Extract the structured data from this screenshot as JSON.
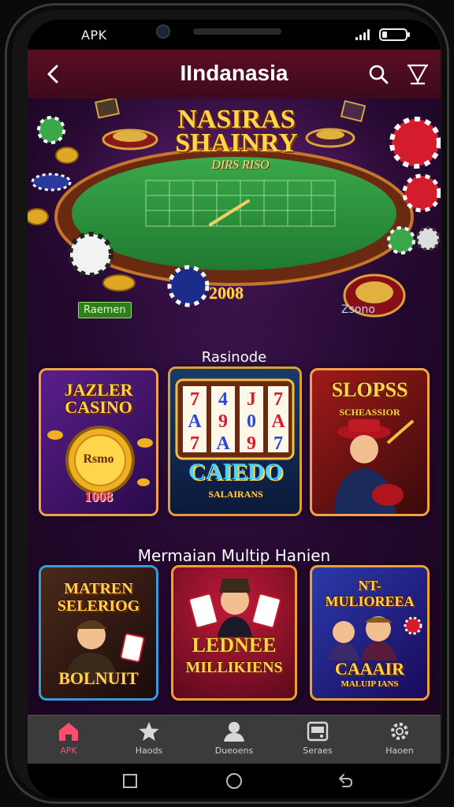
{
  "status_bar": {
    "carrier": "APK"
  },
  "header": {
    "title": "IIndanasia",
    "back_icon": "back-chevron-icon",
    "search_icon": "search-icon",
    "filter_icon": "filter-icon"
  },
  "hero": {
    "title_line1": "NASIRAS",
    "title_line2": "SHAINRY",
    "subtitle": "DIRS RISO",
    "badge_left": "Raemen",
    "number": "2008",
    "badge_right": "Zsono"
  },
  "sections": {
    "section1_title": "Rasinode",
    "section2_title": "Mermaian Multip Hanien"
  },
  "cards_row1": [
    {
      "title_line1": "JAZLER",
      "title_line2": "CASINO",
      "coin_text": "Rsmo",
      "footer": "1008"
    },
    {
      "reel_symbols": "7 4 J 7 | A 9 0 A | 7 A 9 7",
      "title": "CAIEDO",
      "sub": "SALAIRANS"
    },
    {
      "title": "SLOPSS",
      "sub": "SCHEASSIOR"
    }
  ],
  "cards_row2": [
    {
      "title_line1": "MATREN",
      "title_line2": "SELERIOG",
      "footer": "BOLNUIT"
    },
    {
      "title_line1": "LEDNEE",
      "title_line2": "MILLIKIENS"
    },
    {
      "title_line1": "NT-",
      "title_line2": "MULIOREEA",
      "footer": "CAAAIR",
      "footer2": "MALUIP IANS"
    }
  ],
  "bottom_nav": [
    {
      "label": "APK",
      "icon": "home-icon",
      "active": true
    },
    {
      "label": "Haods",
      "icon": "star-icon",
      "active": false
    },
    {
      "label": "Dueoens",
      "icon": "user-icon",
      "active": false
    },
    {
      "label": "Seraes",
      "icon": "slot-icon",
      "active": false
    },
    {
      "label": "Haoen",
      "icon": "settings-icon",
      "active": false
    }
  ],
  "colors": {
    "header_bg": "#4a0c1e",
    "content_bg": "#2a0a36",
    "accent_gold": "#ffd54a",
    "card_border": "#f3a24a",
    "nav_active": "#ff4d6d"
  }
}
